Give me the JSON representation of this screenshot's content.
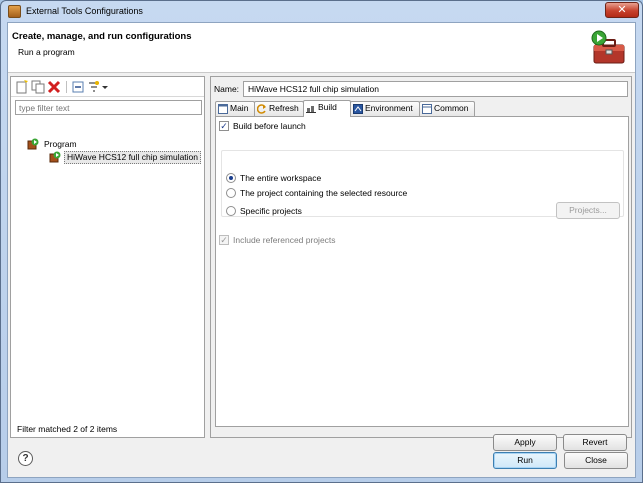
{
  "window": {
    "title": "External Tools Configurations",
    "close_glyph": "✕"
  },
  "banner": {
    "title": "Create, manage, and run configurations",
    "subtitle": "Run a program",
    "icon": "toolbox-run-icon"
  },
  "left": {
    "toolbar_icons": [
      "new-config-icon",
      "duplicate-icon",
      "delete-icon",
      "collapse-all-icon",
      "filter-icon",
      "dropdown-arrow-icon"
    ],
    "filter_placeholder": "type filter text",
    "filter_value": "",
    "tree": {
      "category": "Program",
      "child": "HiWave HCS12 full chip simulation"
    },
    "status": "Filter matched 2 of 2 items"
  },
  "right": {
    "name_label": "Name:",
    "name_value": "HiWave HCS12 full chip simulation",
    "tabs": [
      {
        "label": "Main",
        "icon": "main-tab-icon"
      },
      {
        "label": "Refresh",
        "icon": "refresh-icon"
      },
      {
        "label": "Build",
        "icon": "build-icon",
        "active": true
      },
      {
        "label": "Environment",
        "icon": "environment-icon"
      },
      {
        "label": "Common",
        "icon": "common-icon"
      }
    ],
    "build": {
      "build_before_launch": {
        "label": "Build before launch",
        "checked": true
      },
      "radios": [
        {
          "label": "The entire workspace",
          "selected": true
        },
        {
          "label": "The project containing the selected resource",
          "selected": false
        },
        {
          "label": "Specific projects",
          "selected": false
        }
      ],
      "projects_button": "Projects...",
      "include_referenced": {
        "label": "Include referenced projects",
        "checked": true,
        "enabled": false
      }
    },
    "apply_button": "Apply",
    "revert_button": "Revert"
  },
  "footer": {
    "help_glyph": "?",
    "run_button": "Run",
    "close_button": "Close"
  },
  "colors": {
    "window_frame": "#b7cde9",
    "dialog_bg": "#f0f0f0",
    "selection_radio": "#1c3f8e",
    "close_button": "#c7422d"
  }
}
